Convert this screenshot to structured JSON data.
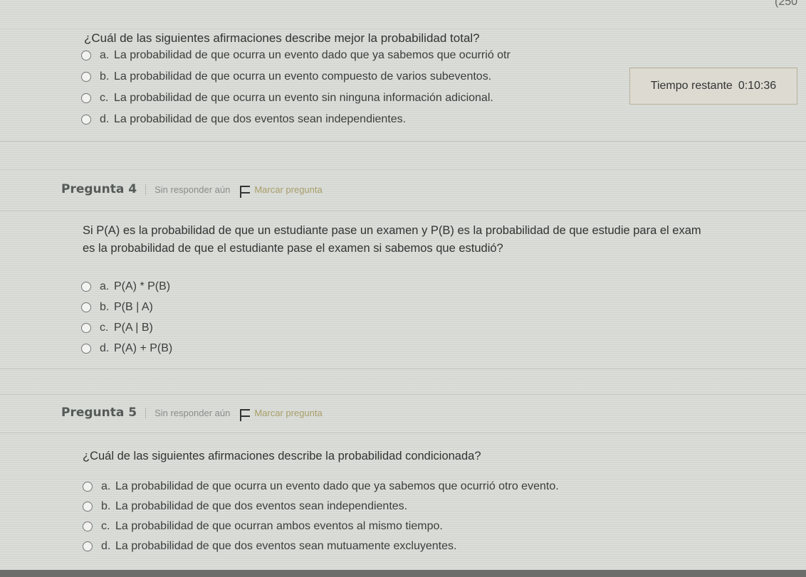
{
  "top_right_fragment": "(250",
  "q3": {
    "text": "¿Cuál de las siguientes afirmaciones describe mejor la probabilidad total?",
    "options": [
      {
        "letter": "a.",
        "text": "La probabilidad de que ocurra un evento dado que ya sabemos que ocurrió otr"
      },
      {
        "letter": "b.",
        "text": "La probabilidad de que ocurra un evento compuesto de varios subeventos."
      },
      {
        "letter": "c.",
        "text": "La probabilidad de que ocurra un evento sin ninguna información adicional."
      },
      {
        "letter": "d.",
        "text": "La probabilidad de que dos eventos sean independientes."
      }
    ]
  },
  "timer": {
    "label": "Tiempo restante",
    "value": "0:10:36"
  },
  "q4": {
    "number": "Pregunta 4",
    "status": "Sin responder aún",
    "flag_label": "Marcar pregunta",
    "text_line1": "Si P(A) es la probabilidad de que un estudiante pase un examen y P(B) es la probabilidad de que estudie para el exam",
    "text_line2": "es la probabilidad de que el estudiante pase el examen si sabemos que estudió?",
    "options": [
      {
        "letter": "a.",
        "text": "P(A) * P(B)"
      },
      {
        "letter": "b.",
        "text": "P(B | A)"
      },
      {
        "letter": "c.",
        "text": "P(A | B)"
      },
      {
        "letter": "d.",
        "text": "P(A) + P(B)"
      }
    ]
  },
  "q5": {
    "number": "Pregunta 5",
    "status": "Sin responder aún",
    "flag_label": "Marcar pregunta",
    "text": "¿Cuál de las siguientes afirmaciones describe la probabilidad condicionada?",
    "options": [
      {
        "letter": "a.",
        "text": "La probabilidad de que ocurra un evento dado que ya sabemos que ocurrió otro evento."
      },
      {
        "letter": "b.",
        "text": "La probabilidad de que dos eventos sean independientes."
      },
      {
        "letter": "c.",
        "text": "La probabilidad de que ocurran ambos eventos al mismo tiempo."
      },
      {
        "letter": "d.",
        "text": "La probabilidad de que dos eventos sean mutuamente excluyentes."
      }
    ]
  }
}
